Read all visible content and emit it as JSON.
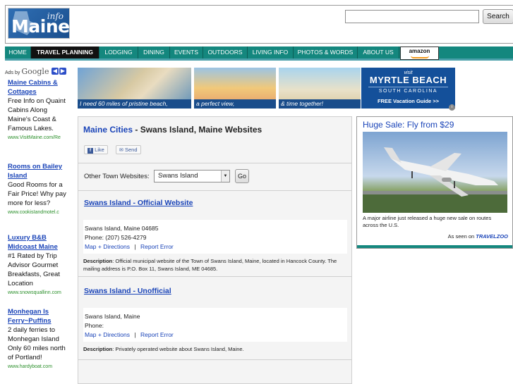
{
  "logo": {
    "word": "Maine",
    "info": "info"
  },
  "search": {
    "placeholder": "",
    "button_label": "Search"
  },
  "nav": {
    "items": [
      {
        "label": "HOME"
      },
      {
        "label": "TRAVEL PLANNING"
      },
      {
        "label": "LODGING"
      },
      {
        "label": "DINING"
      },
      {
        "label": "EVENTS"
      },
      {
        "label": "OUTDOORS"
      },
      {
        "label": "LIVING INFO"
      },
      {
        "label": "PHOTOS & WORDS"
      },
      {
        "label": "ABOUT US"
      }
    ],
    "amazon_label": "amazon"
  },
  "left_ads": {
    "adsby": "Ads by",
    "google": "Google",
    "items": [
      {
        "title": "Maine Cabins & Cottages",
        "body": "Free Info on Quaint Cabins Along Maine's Coast & Famous Lakes.",
        "url": "www.VisitMaine.com/Re"
      },
      {
        "title": "Rooms on Bailey Island",
        "body": "Good Rooms for a Fair Price! Why pay more for less?",
        "url": "www.cookisIandmotel.c"
      },
      {
        "title": "Luxury B&B Midcoast Maine",
        "body": "#1 Rated by Trip Advisor Gourmet Breakfasts, Great Location",
        "url": "www.snowsquallinn.com"
      },
      {
        "title": "Monhegan Is Ferry~Puffins",
        "body": "2 daily ferries to Monhegan Island Only 60 miles north of Portland!",
        "url": "www.hardyboat.com"
      }
    ]
  },
  "banner": {
    "captions": [
      "I need 60 miles of pristine beach,",
      "a perfect view,",
      "& time together!"
    ],
    "visit": "visit",
    "brand": "MYRTLE BEACH",
    "region": "SOUTH CAROLINA",
    "cta": "FREE Vacation Guide >>"
  },
  "main": {
    "heading_city": "Maine Cities",
    "heading_rest": " - Swans Island, Maine Websites",
    "like_label": "Like",
    "send_label": "Send",
    "other_towns_label": "Other Town Websites:",
    "selected_town": "Swans Island",
    "go_label": "Go",
    "listings": [
      {
        "title": "Swans Island - Official Website",
        "addr1": "Swans Island, Maine 04685",
        "phone": "Phone: (207) 526-4279",
        "map_link": "Map + Directions",
        "sep": "|",
        "report_link": "Report Error",
        "desc_label": "Description",
        "desc_text": ": Official municipal website of the Town of Swans Island, Maine, located in Hancock County. The mailing address is P.O. Box 11, Swans Island, ME 04685."
      },
      {
        "title": "Swans Island - Unofficial",
        "addr1": "Swans Island, Maine",
        "phone": "Phone:",
        "map_link": "Map + Directions",
        "sep": "|",
        "report_link": "Report Error",
        "desc_label": "Description",
        "desc_text": ": Privately operated website about Swans Island, Maine."
      }
    ]
  },
  "right_ad": {
    "title": "Huge Sale: Fly from $29",
    "caption": "A major airline just released a huge new sale on routes across the U.S.",
    "seen_on": "As seen on",
    "brand": "TRAVELZOO"
  }
}
